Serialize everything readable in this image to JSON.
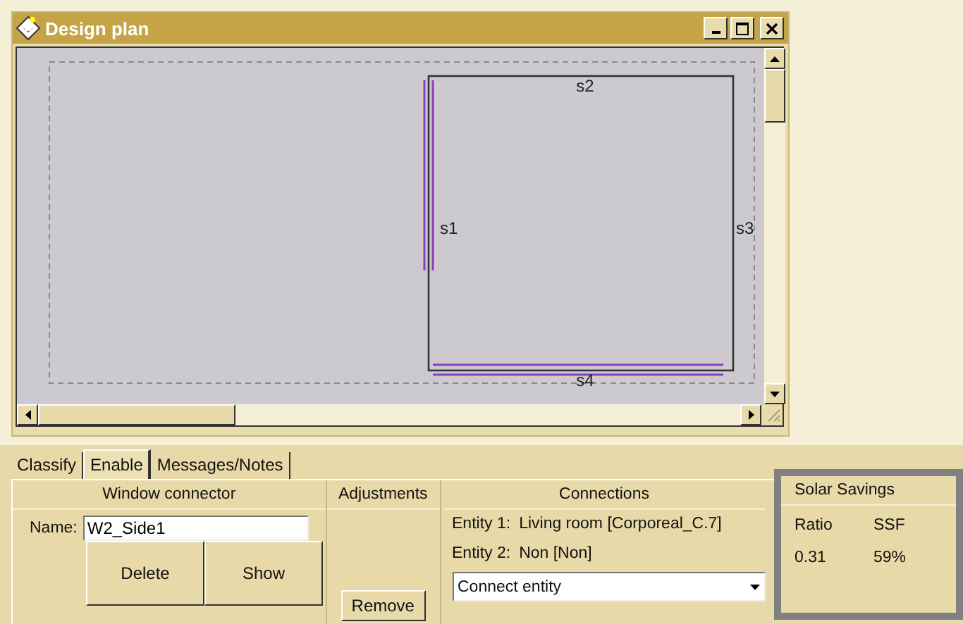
{
  "window": {
    "title": "Design plan"
  },
  "plan": {
    "sides": [
      {
        "label": "s1"
      },
      {
        "label": "s2"
      },
      {
        "label": "s3"
      },
      {
        "label": "s4"
      }
    ]
  },
  "tabs": [
    {
      "label": "Classify",
      "selected": false
    },
    {
      "label": "Enable",
      "selected": true
    },
    {
      "label": "Messages/Notes",
      "selected": false
    }
  ],
  "window_connector": {
    "title": "Window connector",
    "name_label": "Name:",
    "name_value": "W2_Side1",
    "buttons": [
      "Delete",
      "Show"
    ]
  },
  "adjustments": {
    "title": "Adjustments",
    "button": "Remove"
  },
  "connections": {
    "title": "Connections",
    "entities": [
      {
        "label": "Entity 1:",
        "value": "Living room [Corporeal_C.7]"
      },
      {
        "label": "Entity 2:",
        "value": "Non [Non]"
      }
    ],
    "dropdown": "Connect entity"
  },
  "solar_savings": {
    "title": "Solar Savings",
    "columns": [
      "Ratio",
      "SSF"
    ],
    "values": [
      "0.31",
      "59%"
    ]
  }
}
